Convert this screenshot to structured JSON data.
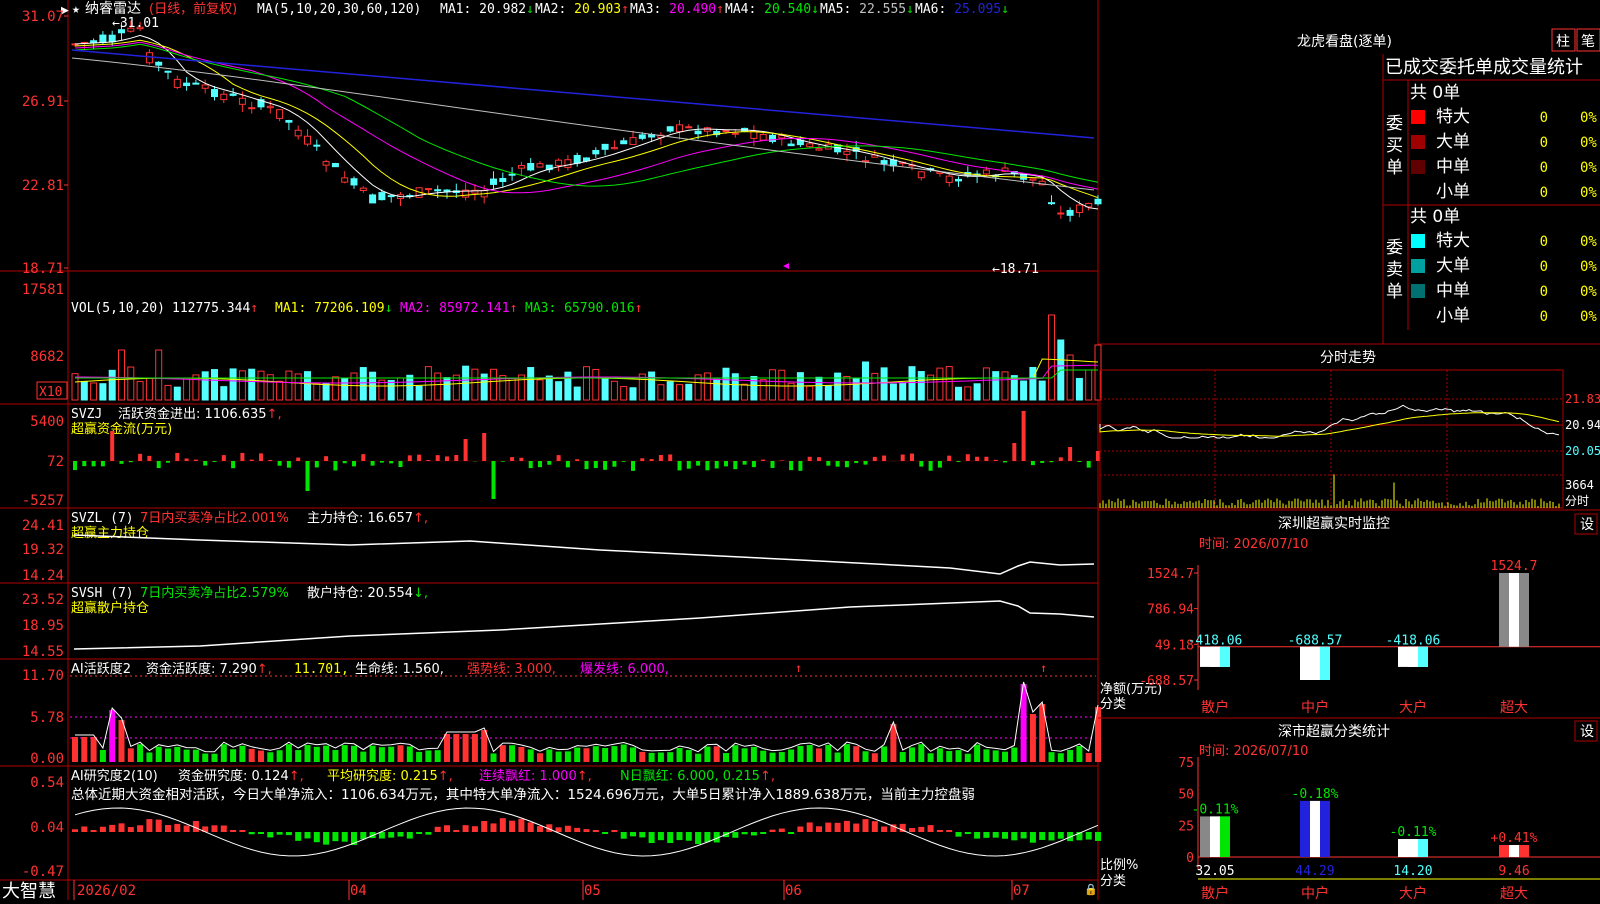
{
  "colors": {
    "up": "#ff3232",
    "down": "#54ffff",
    "green": "#00e600",
    "white": "#ffffff",
    "yellow": "#ffff00",
    "magenta": "#ff00ff",
    "grid": "#b00000",
    "blue": "#2222dd"
  },
  "price_panel": {
    "star": "★",
    "stock_name": "纳睿雷达",
    "period": "(日线，前复权)",
    "ma_label": "MA(5,10,20,30,60,120)",
    "ma_items": [
      {
        "label": "MA1:",
        "value": "20.982",
        "arrow": "↓",
        "color": "#ffffff"
      },
      {
        "label": "MA2:",
        "value": "20.903",
        "arrow": "↑",
        "color": "#ffff00"
      },
      {
        "label": "MA3:",
        "value": "20.490",
        "arrow": "↑",
        "color": "#ff00ff"
      },
      {
        "label": "MA4:",
        "value": "20.540",
        "arrow": "↓",
        "color": "#00e600"
      },
      {
        "label": "MA5:",
        "value": "22.555",
        "arrow": "↓",
        "color": "#c0c0c0"
      },
      {
        "label": "MA6:",
        "value": "25.095",
        "arrow": "↓",
        "color": "#2222dd"
      }
    ],
    "y_ticks": [
      "31.07",
      "26.91",
      "22.81",
      "18.71"
    ],
    "high_marker": "31.01",
    "low_marker": "18.71"
  },
  "volume_panel": {
    "label": "VOL(5,10,20)",
    "value": "112775.344",
    "value_arrow": "↑",
    "ma_items": [
      {
        "label": "MA1:",
        "value": "77206.109",
        "arrow": "↓",
        "color": "#ffff00"
      },
      {
        "label": "MA2:",
        "value": "85972.141",
        "arrow": "↑",
        "color": "#ff00ff"
      },
      {
        "label": "MA3:",
        "value": "65790.016",
        "arrow": "↑",
        "color": "#00e600"
      }
    ],
    "y_ticks": [
      "17581",
      "8682"
    ],
    "unit": "X10"
  },
  "svzj_panel": {
    "label": "SVZJ",
    "text": "活跃资金进出: 1106.635",
    "arrow": "↑,",
    "subtitle": "超赢资金流(万元)",
    "y_ticks": [
      "5400",
      "72",
      "-5257"
    ]
  },
  "svzl_panel": {
    "label": "SVZL (7)",
    "pct": "7日内买卖净占比2.001%",
    "text": "主力持仓: 16.657",
    "arrow": "↑,",
    "subtitle": "超赢主力持仓",
    "y_ticks": [
      "24.41",
      "19.32",
      "14.24"
    ]
  },
  "svsh_panel": {
    "label": "SVSH (7)",
    "pct": "7日内买卖净占比2.579%",
    "text": "散户持仓: 20.554",
    "arrow": "↓,",
    "subtitle": "超赢散户持仓",
    "y_ticks": [
      "23.52",
      "18.95",
      "14.55"
    ]
  },
  "ai_active_panel": {
    "label": "AI活跃度2",
    "text": "资金活跃度: 7.290",
    "v2": "11.701,",
    "life": "生命线: 1.560,",
    "strong": "强势线: 3.000,",
    "burst": "爆发线: 6.000,",
    "y_ticks": [
      "11.70",
      "5.78",
      "0.00"
    ]
  },
  "ai_research_panel": {
    "label": "AI研究度2(10)",
    "text": "资金研究度: 0.124",
    "avg": "平均研究度: 0.215",
    "cont": "连续飘红: 1.000",
    "nday": "N日飘红: 6.000, 0.215",
    "summary": "总体近期大资金相对活跃，今日大单净流入：1106.634万元，其中特大单净流入：1524.696万元，大单5日累计净入1889.638万元，当前主力控盘弱",
    "y_ticks": [
      "0.54",
      "0.04",
      "-0.47"
    ]
  },
  "x_axis": {
    "labels": [
      "2026/02",
      "04",
      "05",
      "06",
      "07"
    ]
  },
  "brand": "大智慧",
  "dragon_tiger": {
    "title": "龙虎看盘(逐单)",
    "btn_column": "柱",
    "btn_pen": "笔",
    "header": "已成交委托单成交量统计",
    "buy": {
      "side_label": "委买单",
      "total": "共 0单",
      "rows": [
        {
          "color": "#ff0000",
          "label": "特大",
          "value": "0",
          "pct": "0%"
        },
        {
          "color": "#a00000",
          "label": "大单",
          "value": "0",
          "pct": "0%"
        },
        {
          "color": "#600000",
          "label": "中单",
          "value": "0",
          "pct": "0%"
        },
        {
          "color": "",
          "label": "小单",
          "value": "0",
          "pct": "0%"
        }
      ]
    },
    "sell": {
      "side_label": "委卖单",
      "total": "共 0单",
      "rows": [
        {
          "color": "#00ffff",
          "label": "特大",
          "value": "0",
          "pct": "0%"
        },
        {
          "color": "#00a0a0",
          "label": "大单",
          "value": "0",
          "pct": "0%"
        },
        {
          "color": "#007070",
          "label": "中单",
          "value": "0",
          "pct": "0%"
        },
        {
          "color": "",
          "label": "小单",
          "value": "0",
          "pct": "0%"
        }
      ]
    }
  },
  "intraday": {
    "title": "分时走势",
    "prices": [
      "21.83",
      "20.94",
      "20.05"
    ],
    "volume": "3664",
    "vol_label": "分时"
  },
  "sz_monitor": {
    "title": "深圳超赢实时监控",
    "settings": "设",
    "time": "时间: 2026/07/10",
    "y_ticks": [
      "1524.7",
      "786.94",
      "49.18",
      "-688.57"
    ],
    "ylabel": "净额(万元)",
    "xlabel": "分类",
    "categories": [
      "散户",
      "中户",
      "大户",
      "超大"
    ],
    "value_labels": [
      "-418.06",
      "-688.57",
      "-418.06",
      "1524.7"
    ]
  },
  "sz_stats": {
    "title": "深市超赢分类统计",
    "settings": "设",
    "time": "时间: 2026/07/10",
    "y_ticks": [
      "75",
      "50",
      "25",
      "0"
    ],
    "ylabel": "比例%",
    "xlabel": "分类",
    "categories": [
      "散户",
      "中户",
      "大户",
      "超大"
    ],
    "change_labels": [
      "-0.11%",
      "-0.18%",
      "-0.11%",
      "+0.41%"
    ],
    "values": [
      "32.05",
      "44.29",
      "14.20",
      "9.46"
    ]
  },
  "chart_data": [
    {
      "type": "bar",
      "title": "深圳超赢实时监控",
      "ylabel": "净额(万元)",
      "xlabel": "分类",
      "categories": [
        "散户",
        "中户",
        "大户",
        "超大"
      ],
      "values": [
        -418.06,
        -688.57,
        -418.06,
        1524.7
      ],
      "ylim": [
        -688.57,
        1524.7
      ]
    },
    {
      "type": "bar",
      "title": "深市超赢分类统计",
      "ylabel": "比例%",
      "xlabel": "分类",
      "categories": [
        "散户",
        "中户",
        "大户",
        "超大"
      ],
      "values": [
        32.05,
        44.29,
        14.2,
        9.46
      ],
      "ylim": [
        0,
        75
      ]
    }
  ]
}
